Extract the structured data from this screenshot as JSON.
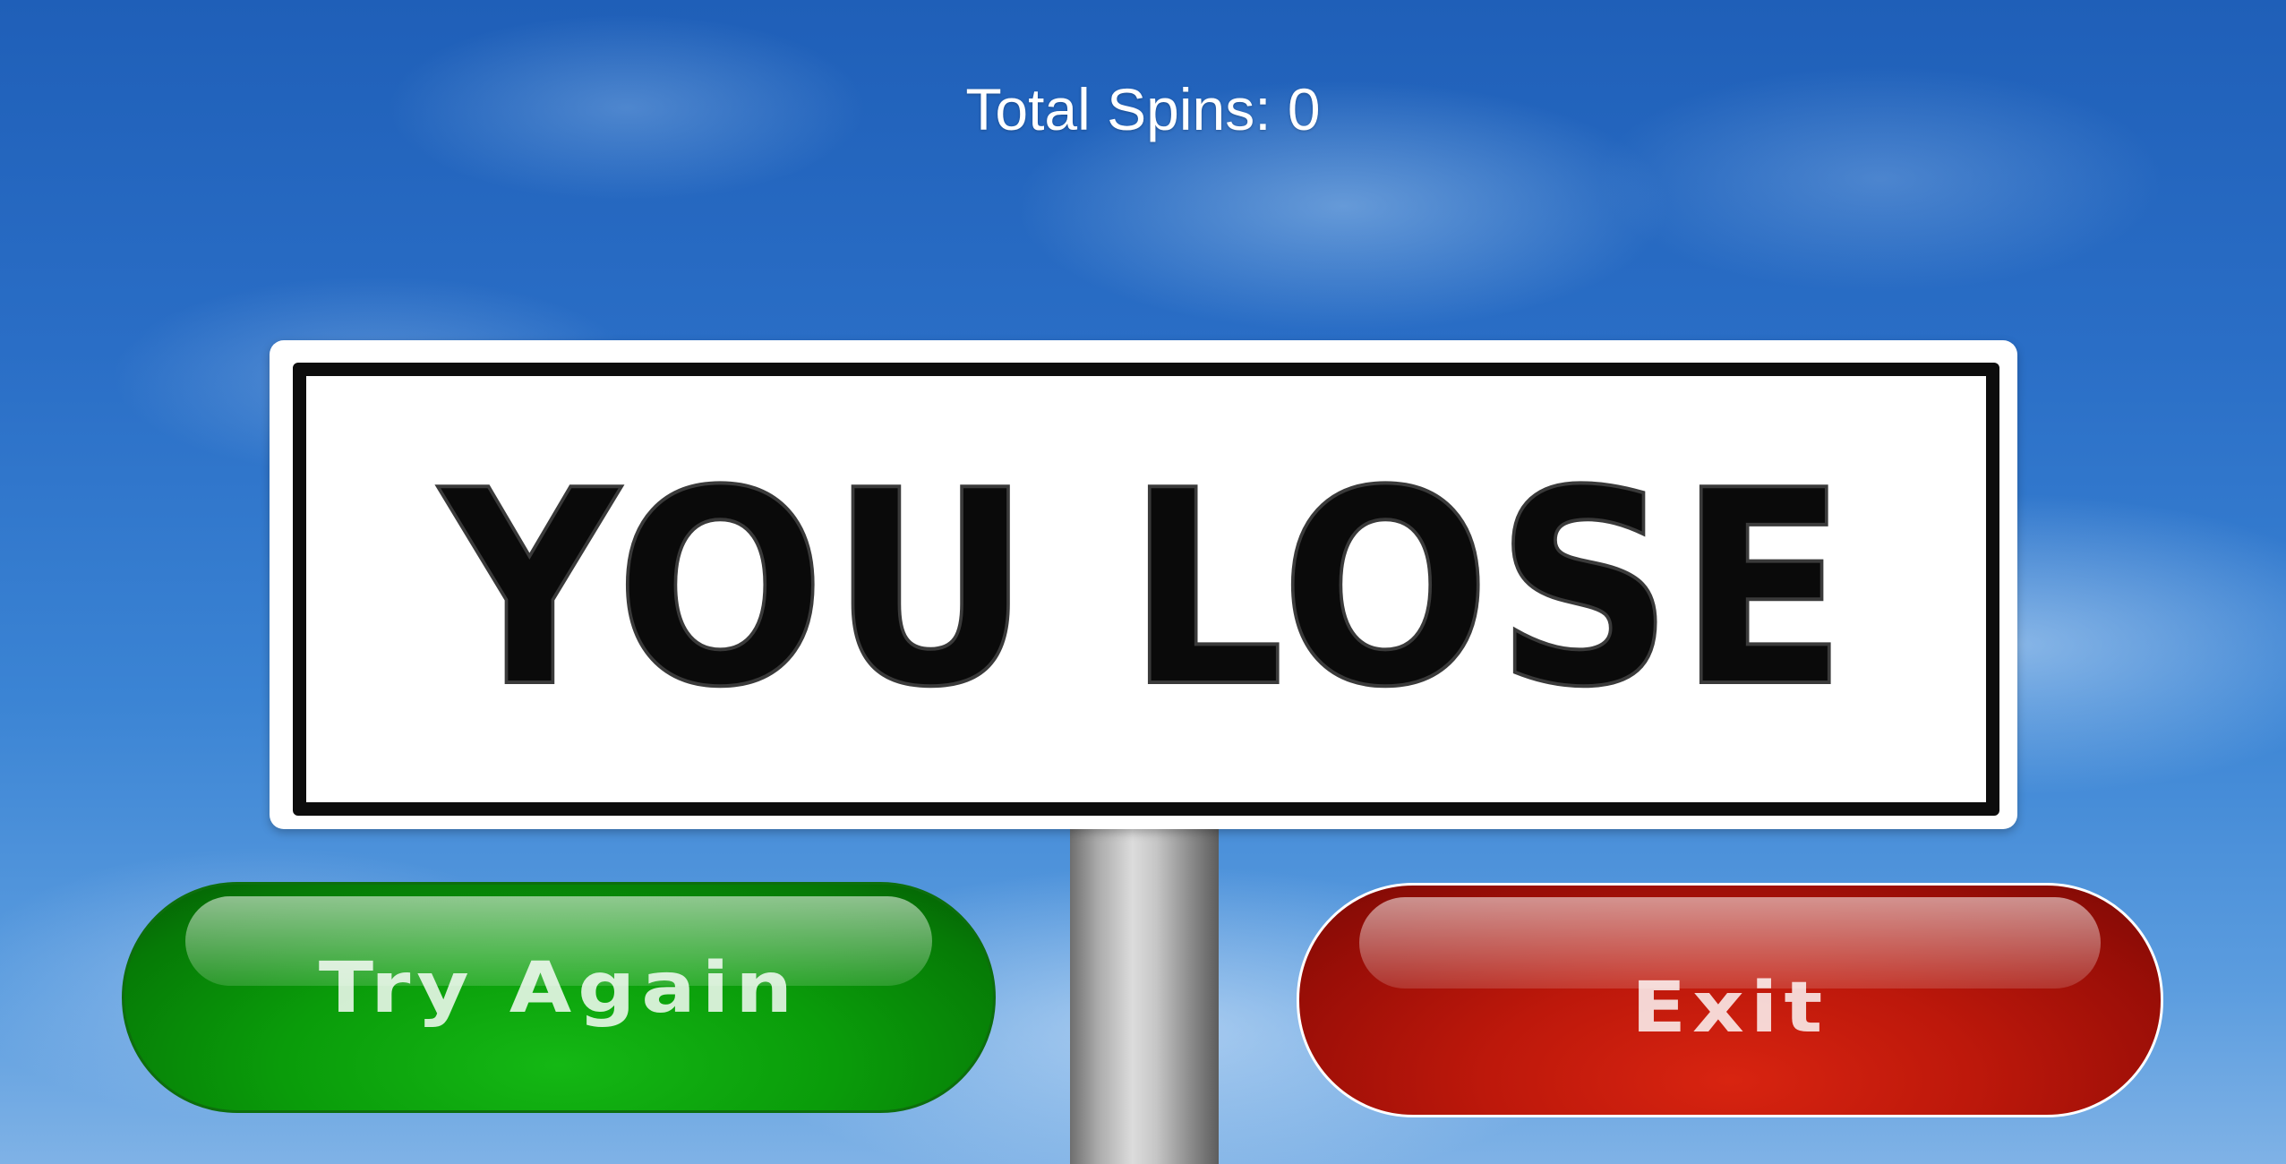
{
  "hud": {
    "total_spins": "Total Spins: 0"
  },
  "sign": {
    "message": "YOU LOSE"
  },
  "buttons": {
    "try_again_label": "Try Again",
    "exit_label": "Exit"
  },
  "colors": {
    "sky": "#2a6ec6",
    "try_again": "#0a9c0a",
    "exit": "#bd180b",
    "sign_border": "#0d0d0d"
  }
}
